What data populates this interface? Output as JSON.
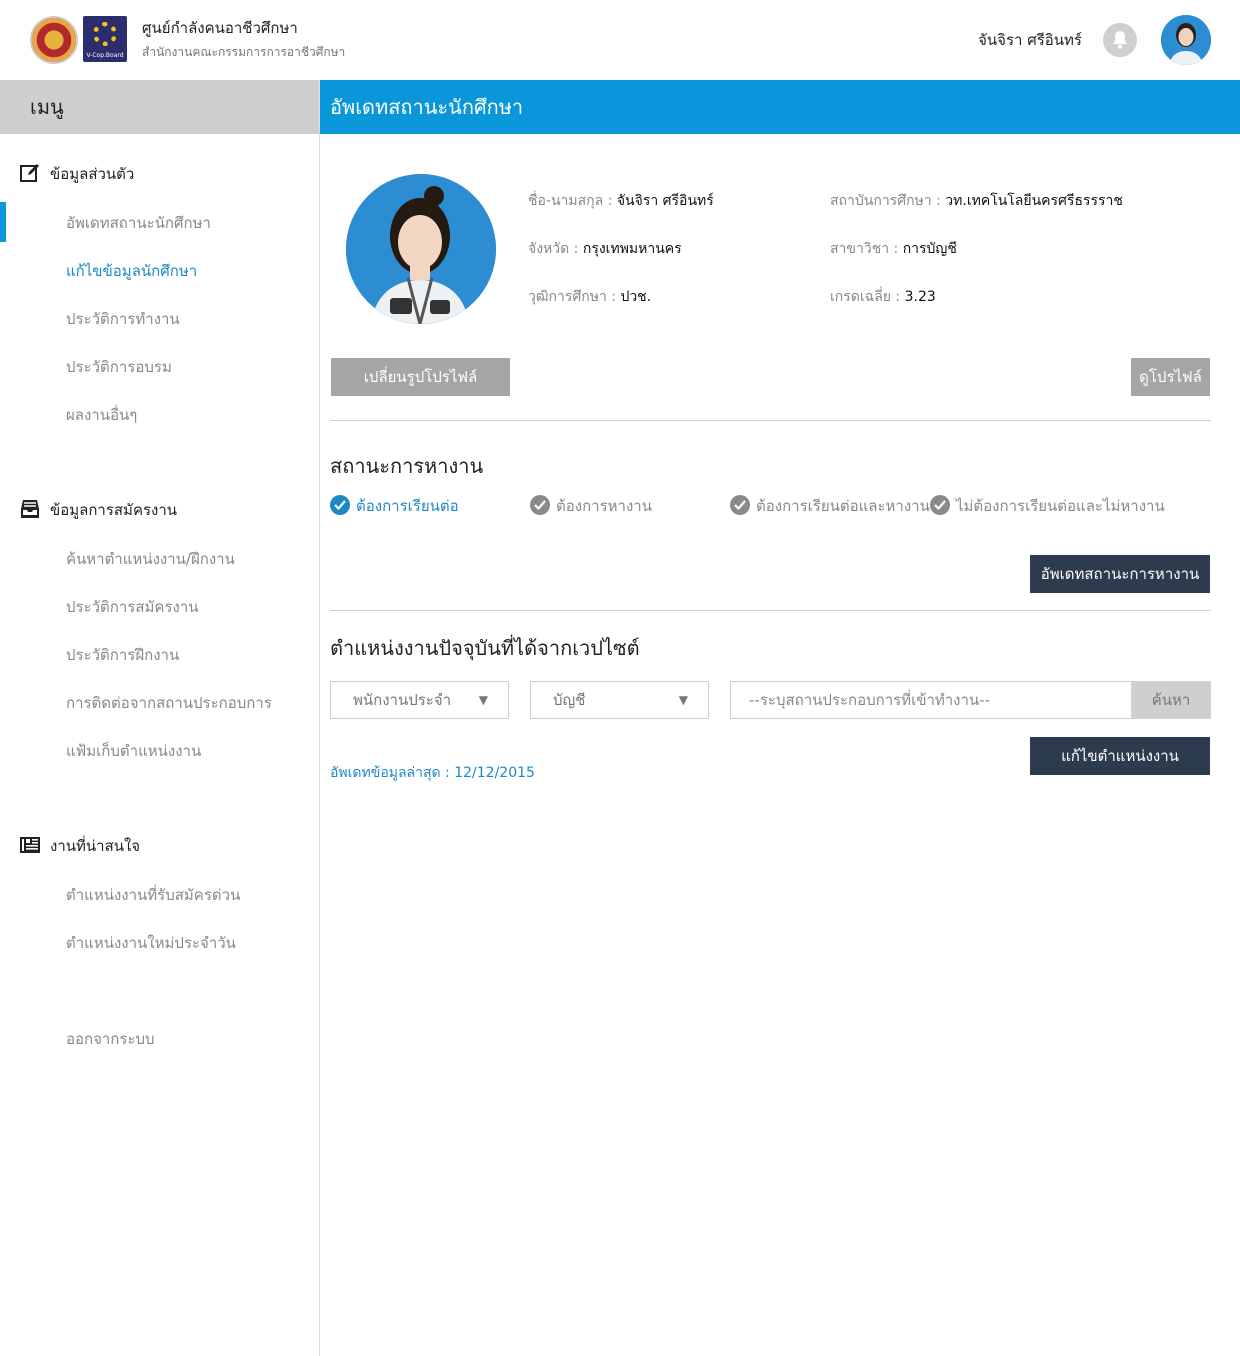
{
  "header": {
    "org_title": "ศูนย์กำลังคนอาชีวศึกษา",
    "org_subtitle": "สำนักงานคณะกรรมการการอาชีวศึกษา",
    "logo2_text": "V-Cop.Board",
    "user_name": "จันจิรา  ศรีอินทร์"
  },
  "sidebar": {
    "menu_title": "เมนู",
    "sections": [
      {
        "title": "ข้อมูลส่วนตัว",
        "icon": "edit-icon",
        "items": [
          "อัพเดทสถานะนักศึกษา",
          "แก้ไขข้อมูลนักศึกษา",
          "ประวัติการทำงาน",
          "ประวัติการอบรม",
          "ผลงานอื่นๆ"
        ]
      },
      {
        "title": "ข้อมูลการสมัครงาน",
        "icon": "inbox-icon",
        "items": [
          "ค้นหาตำแหน่งงาน/ฝึกงาน",
          "ประวัติการสมัครงาน",
          "ประวัติการฝึกงาน",
          "การติดต่อจากสถานประกอบการ",
          "แฟ้มเก็บตำแหน่งงาน"
        ]
      },
      {
        "title": "งานที่น่าสนใจ",
        "icon": "news-icon",
        "items": [
          "ตำแหน่งงานที่รับสมัครด่วน",
          "ตำแหน่งงานใหม่ประจำวัน"
        ]
      }
    ],
    "logout": "ออกจากระบบ"
  },
  "main": {
    "page_title": "อัพเดทสถานะนักศึกษา",
    "profile": {
      "name_label": "ชื่อ-นามสกุล : ",
      "name_value": "จันจิรา  ศรีอินทร์",
      "province_label": "จังหวัด : ",
      "province_value": "กรุงเทพมหานคร",
      "degree_label": "วุฒิการศึกษา : ",
      "degree_value": "ปวช.",
      "institute_label": "สถาบันการศึกษา : ",
      "institute_value": "วท.เทคโนโลยีนครศรีธรรราช",
      "major_label": "สาขาวิชา : ",
      "major_value": "การบัญชี",
      "gpa_label": "เกรดเฉลี่ย : ",
      "gpa_value": "3.23"
    },
    "change_photo_button": "เปลี่ยนรูปโปรไฟล์",
    "view_profile_button": "ดูโปรไฟล์",
    "job_status": {
      "title": "สถานะการหางาน",
      "options": [
        {
          "label": "ต้องการเรียนต่อ",
          "selected": true
        },
        {
          "label": "ต้องการหางาน",
          "selected": false
        },
        {
          "label": "ต้องการเรียนต่อและหางาน",
          "selected": false
        },
        {
          "label": "ไม่ต้องการเรียนต่อและไม่หางาน",
          "selected": false
        }
      ],
      "update_button": "อัพเดทสถานะการหางาน"
    },
    "current_job": {
      "title": "ตำแหน่งงานปัจจุบันที่ได้จากเวปไซต์",
      "position_select": "พนักงานประจำ",
      "field_select": "บัญชี",
      "company_placeholder": "--ระบุสถานประกอบการที่เข้าทำงาน--",
      "search_button": "ค้นหา",
      "edit_button": "แก้ไขตำแหน่งงาน",
      "last_update": "อัพเดทข้อมูลล่าสุด : 12/12/2015"
    }
  },
  "colors": {
    "accent": "#0a97d9",
    "dark_button": "#2d3b4f",
    "gray_button": "#a5a5a5",
    "link": "#1e88c7"
  }
}
